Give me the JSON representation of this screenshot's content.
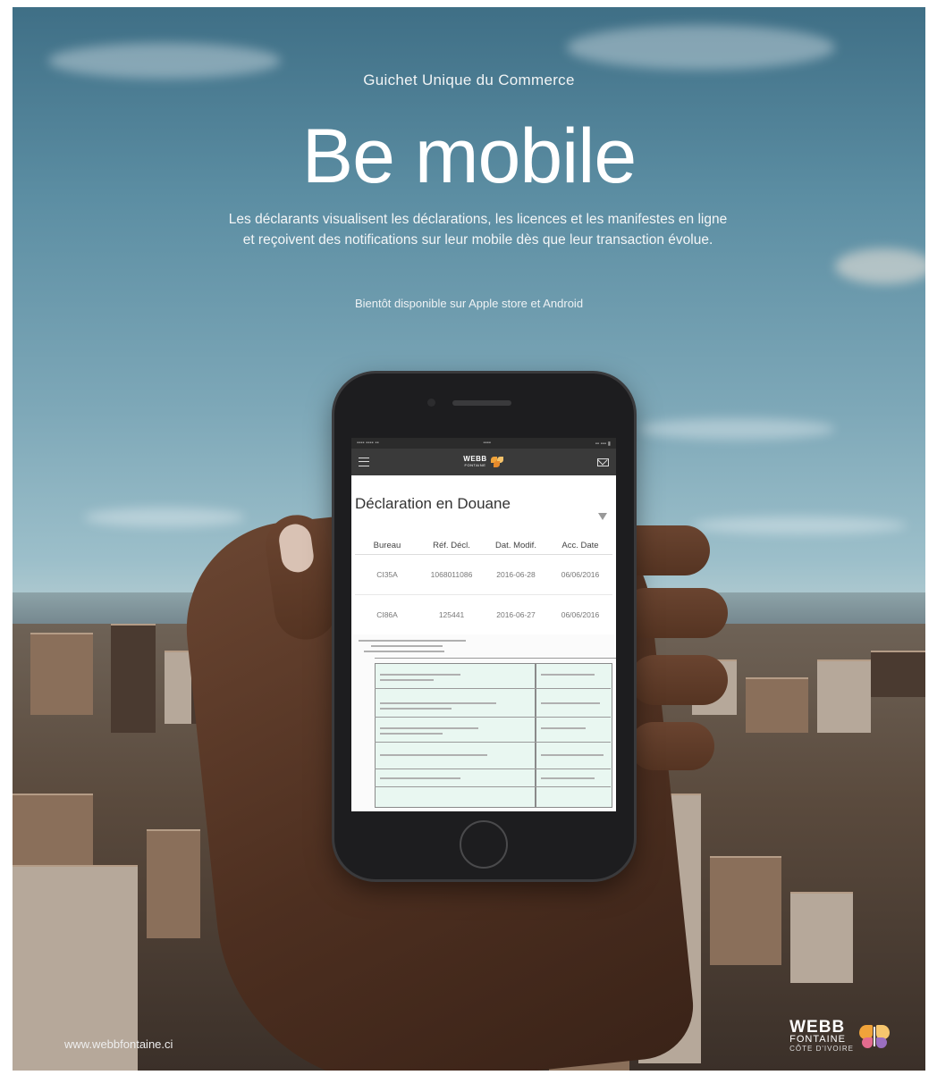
{
  "poster": {
    "kicker": "Guichet Unique du Commerce",
    "headline": "Be mobile",
    "description_line1": "Les déclarants visualisent les déclarations, les licences et les manifestes en ligne",
    "description_line2": "et reçoivent des notifications sur leur mobile dès que leur transaction évolue.",
    "availability": "Bientôt disponible sur Apple store et Android",
    "url": "www.webbfontaine.ci",
    "logo_line1": "WEBB",
    "logo_line2": "FONTAINE",
    "logo_line3": "CÔTE D'IVOIRE"
  },
  "phone_screen": {
    "brand_line1": "WEBB",
    "brand_line2": "FONTAINE",
    "title": "Déclaration en Douane",
    "columns": [
      "Bureau",
      "Réf. Décl.",
      "Dat. Modif.",
      "Acc. Date"
    ],
    "rows": [
      [
        "CI35A",
        "1068011086",
        "2016-06-28",
        "06/06/2016"
      ],
      [
        "CI86A",
        "125441",
        "2016-06-27",
        "06/06/2016"
      ]
    ]
  },
  "colors": {
    "sky_top": "#3f6f86",
    "sky_horizon": "#b9cfd3",
    "phone_body": "#1d1d1f",
    "app_bar": "#3a3a3a",
    "brand_orange": "#f0a33a"
  }
}
